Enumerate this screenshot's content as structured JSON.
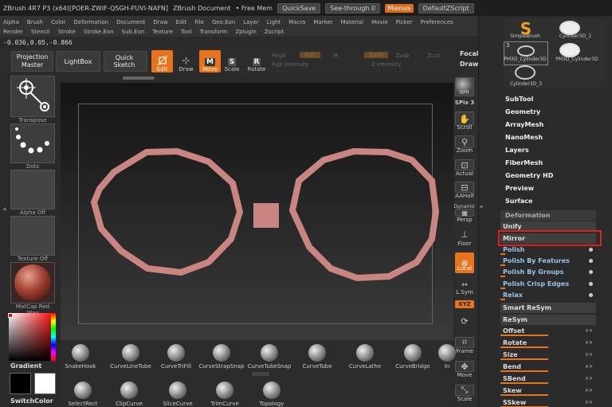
{
  "titlebar": {
    "title": "ZBrush 4R7 P3 (x64)[POER-ZWIF-QSGH-PUVI-NAFN]",
    "doc": "ZBrush Document",
    "mem": "• Free Mem",
    "quicksave": "QuickSave",
    "seethrough": "See-through",
    "seethrough_value": "0",
    "menus": "Menus",
    "script": "DefaultZScript"
  },
  "menus": [
    "Alpha",
    "Brush",
    "Color",
    "Deformation",
    "Document",
    "Draw",
    "Edit",
    "File",
    "Geo.Eon",
    "Layer",
    "Light",
    "Macro",
    "Marker",
    "Material",
    "Movie",
    "Picker",
    "Preferences",
    "Render",
    "Stencil",
    "Stroke",
    "Stroke.Eon",
    "Sub.Eon",
    "Texture",
    "Tool",
    "Transform",
    "Zplugin",
    "Zscript"
  ],
  "coords": "-0.036,0.05,-0.866",
  "toolbar": {
    "projection_master": "Projection Master",
    "lightbox": "LightBox",
    "quick_sketch": "Quick Sketch",
    "edit": "Edit",
    "draw": "Draw",
    "move": "Move",
    "scale": "Scale",
    "rotate": "Rotate",
    "mrgb": "Mrgb",
    "rgb": "Rgb",
    "m": "M",
    "zadd": "Zadd",
    "zsub": "Zsub",
    "zcut": "Zcut",
    "rgb_intensity": "Rgb Intensity",
    "z_intensity": "Z Intensity",
    "focal": "Focal",
    "draw_size": "Draw"
  },
  "left": {
    "transpose": "Transpose",
    "dots": "Dots",
    "alpha_off": "Alpha Off",
    "texture_off": "Texture Off",
    "matcap": "MatCap Red Wax",
    "gradient": "Gradient",
    "switchcolor": "SwitchColor"
  },
  "right_shelf": {
    "bpr": "BPR",
    "spix_label": "SPix",
    "spix_value": "3",
    "scroll": "Scroll",
    "zoom": "Zoom",
    "actual": "Actual",
    "aahalf": "AAHalf",
    "dynamic": "Dynamic",
    "persp": "Persp",
    "floor": "Floor",
    "local": "Local",
    "lsym": "L.Sym",
    "xyz": "XYZ",
    "frame": "Frame",
    "move": "Move",
    "scale": "Scale"
  },
  "brushes_top": [
    "SnakeHook",
    "CurveLineTube",
    "CurveTriFill",
    "CurveStrapSnap",
    "CurveTubeSnap",
    "CurveTube",
    "CurveLathe",
    "CurveBridge",
    "In"
  ],
  "brushes_bottom": [
    "SelectRect",
    "ClipCurve",
    "SliceCurve",
    "TrimCurve",
    "Topology"
  ],
  "tool_palette": {
    "tools": [
      "SimpleBrush",
      "Cylinder3D_1",
      "PM3D_Cylinder3D",
      "PM3D_Cylinder3D",
      "Cylinder3D_3"
    ],
    "count": "3",
    "sections": [
      "SubTool",
      "Geometry",
      "ArrayMesh",
      "NanoMesh",
      "Layers",
      "FiberMesh",
      "Geometry HD",
      "Preview",
      "Surface"
    ]
  },
  "deformation": {
    "header": "Deformation",
    "rows": [
      "Unify",
      "Mirror",
      "Polish",
      "Polish By Features",
      "Polish By Groups",
      "Polish Crisp Edges",
      "Relax",
      "Smart ReSym",
      "ReSym",
      "Offset",
      "Rotate",
      "Size",
      "Bend",
      "SBend",
      "Skew",
      "SSkew"
    ]
  },
  "colors": {
    "accent": "#e8731a",
    "highlight": "#e02020",
    "mesh": "#c98580"
  }
}
